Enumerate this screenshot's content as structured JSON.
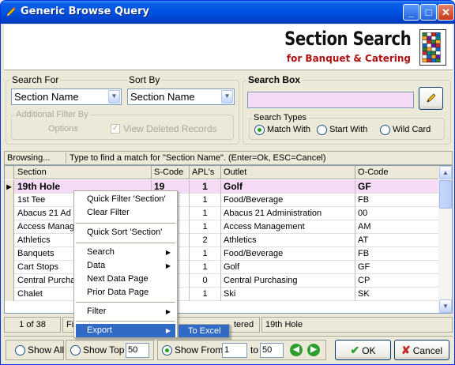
{
  "window": {
    "title": "Generic Browse Query"
  },
  "header": {
    "title": "Section Search",
    "subtitle": "for Banquet & Catering"
  },
  "search_for": {
    "label": "Search For",
    "value": "Section Name"
  },
  "sort_by": {
    "label": "Sort By",
    "value": "Section Name"
  },
  "additional_filter": {
    "label": "Additional Filter By",
    "options_label": "Options",
    "view_deleted_label": "View Deleted Records",
    "view_deleted_checked": true
  },
  "search_box": {
    "label": "Search Box",
    "value": ""
  },
  "search_types": {
    "label": "Search Types",
    "options": [
      "Match With",
      "Start With",
      "Wild Card"
    ],
    "selected": "Match With"
  },
  "status": {
    "mode": "Browsing...",
    "hint": "Type to find a match for \"Section Name\". (Enter=Ok, ESC=Cancel)"
  },
  "grid": {
    "columns": [
      "Section",
      "S-Code",
      "APL's",
      "Outlet",
      "O-Code"
    ],
    "rows": [
      {
        "section": "19th Hole",
        "scode": "19",
        "apls": "1",
        "outlet": "Golf",
        "ocode": "GF"
      },
      {
        "section": "1st Tee",
        "scode": "",
        "apls": "1",
        "outlet": "Food/Beverage",
        "ocode": "FB"
      },
      {
        "section": "Abacus 21 Ad",
        "scode": "",
        "apls": "1",
        "outlet": "Abacus 21 Administration",
        "ocode": "00"
      },
      {
        "section": "Access Manag",
        "scode": "",
        "apls": "1",
        "outlet": "Access Management",
        "ocode": "AM"
      },
      {
        "section": "Athletics",
        "scode": "",
        "apls": "2",
        "outlet": "Athletics",
        "ocode": "AT"
      },
      {
        "section": "Banquets",
        "scode": "",
        "apls": "1",
        "outlet": "Food/Beverage",
        "ocode": "FB"
      },
      {
        "section": "Cart Stops",
        "scode": "",
        "apls": "1",
        "outlet": "Golf",
        "ocode": "GF"
      },
      {
        "section": "Central Purcha",
        "scode": "",
        "apls": "0",
        "outlet": "Central Purchasing",
        "ocode": "CP"
      },
      {
        "section": "Chalet",
        "scode": "",
        "apls": "1",
        "outlet": "Ski",
        "ocode": "SK"
      }
    ]
  },
  "footer": {
    "record_position": "1 of 38",
    "filter_prefix": "Fi",
    "filter_suffix": "tered",
    "current_record": "19th Hole"
  },
  "bottom": {
    "show_all_label": "Show All",
    "show_top_label": "Show Top",
    "show_top_value": "50",
    "show_from_label": "Show From",
    "show_from_value": "1",
    "to_label": "to",
    "to_value": "50",
    "ok_label": "OK",
    "cancel_label": "Cancel",
    "selected_mode": "Show From"
  },
  "context_menu": {
    "items": [
      {
        "label": "Quick Filter 'Section'",
        "submenu": false
      },
      {
        "label": "Clear Filter",
        "submenu": false
      },
      {
        "label": "Quick Sort 'Section'",
        "submenu": false
      },
      {
        "label": "Search",
        "submenu": true
      },
      {
        "label": "Data",
        "submenu": true
      },
      {
        "label": "Next Data Page",
        "submenu": false
      },
      {
        "label": "Prior Data Page",
        "submenu": false
      },
      {
        "label": "Filter",
        "submenu": true
      },
      {
        "label": "Export",
        "submenu": true
      }
    ],
    "highlighted": "Export",
    "submenu_item": "To Excel"
  },
  "colors": {
    "titlebar": "#0054E3",
    "selected_row": "#F6DBF6",
    "menu_highlight": "#316AC5",
    "subtitle": "#B01010"
  }
}
